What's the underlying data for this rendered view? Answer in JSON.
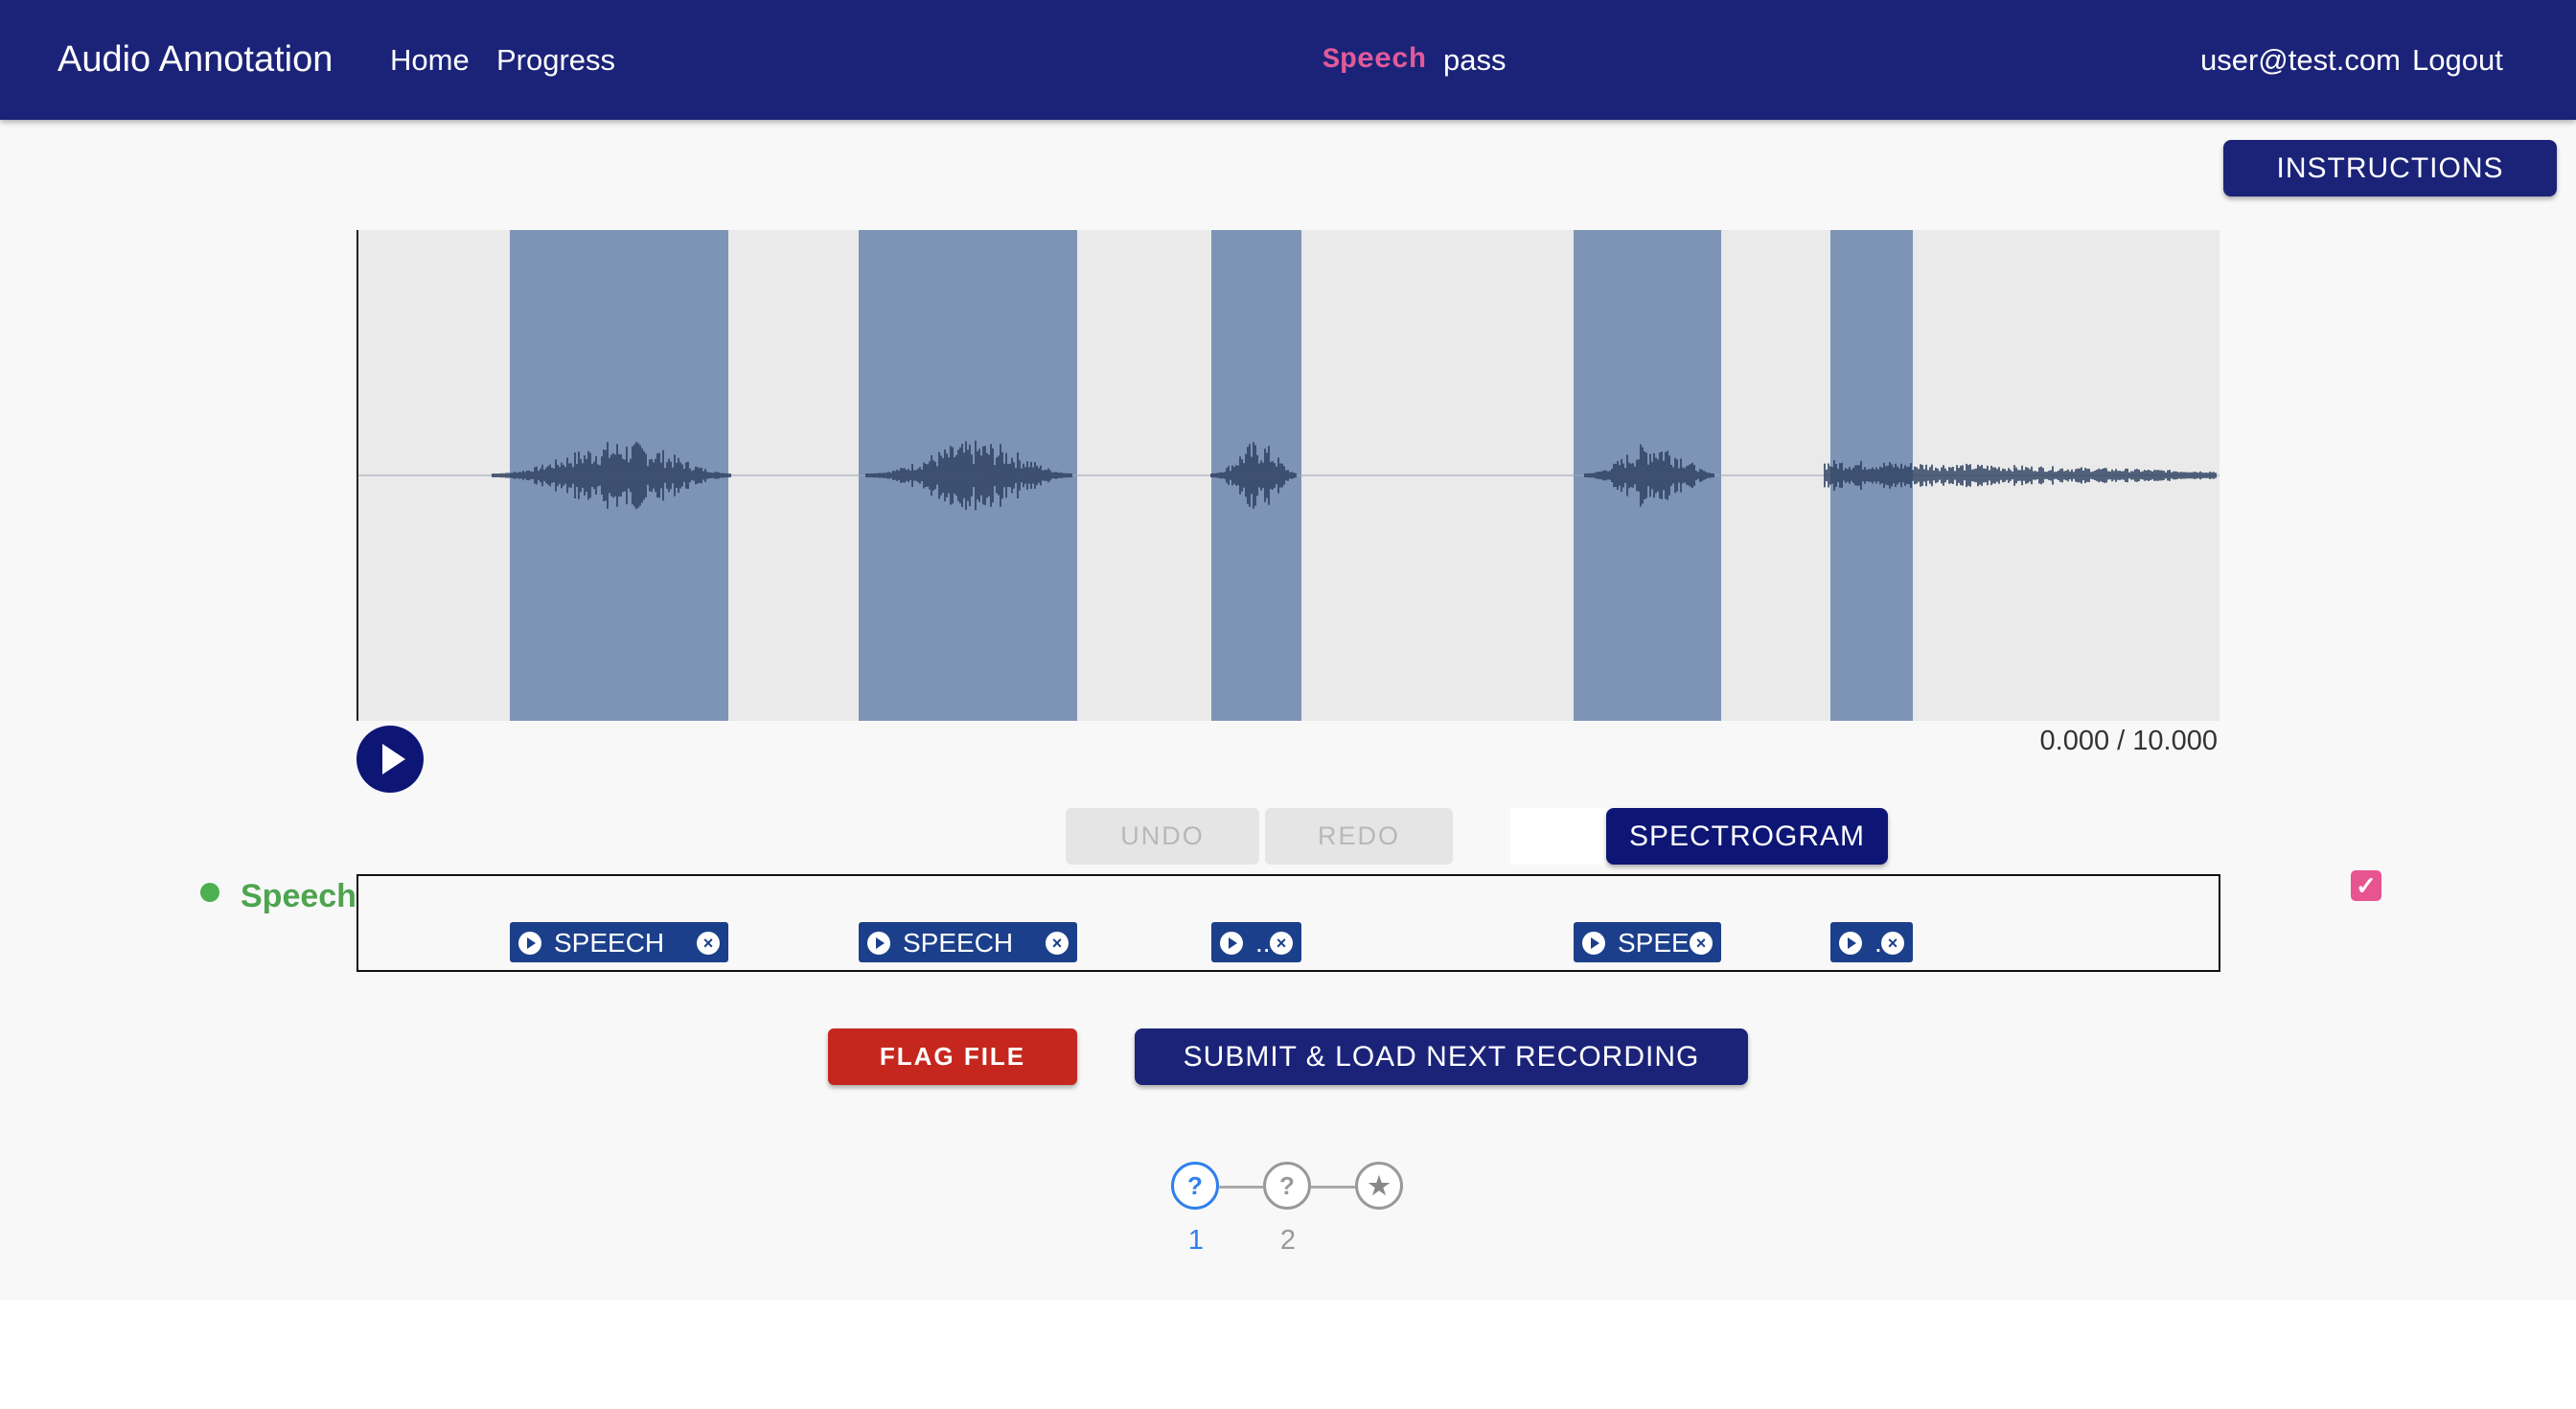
{
  "navbar": {
    "brand": "Audio Annotation",
    "links": [
      "Home",
      "Progress"
    ],
    "task_label": "Speech",
    "task_suffix": "pass",
    "user_email": "user@test.com",
    "logout": "Logout"
  },
  "instructions_label": "INSTRUCTIONS",
  "player": {
    "time": "0.000 / 10.000"
  },
  "toolbar": {
    "undo": "UNDO",
    "redo": "REDO",
    "spectrogram": "SPECTROGRAM"
  },
  "track": {
    "label": "Speech",
    "checked": true,
    "regions": [
      {
        "label": "SPEECH"
      },
      {
        "label": "SPEECH"
      },
      {
        "label": ".."
      },
      {
        "label": "SPEE"
      },
      {
        "label": "."
      }
    ]
  },
  "actions": {
    "flag": "FLAG FILE",
    "submit": "SUBMIT & LOAD NEXT RECORDING"
  },
  "stepper": {
    "steps": [
      {
        "icon": "?",
        "label": "1",
        "active": true
      },
      {
        "icon": "?",
        "label": "2",
        "active": false
      },
      {
        "icon": "★",
        "label": "",
        "active": false
      }
    ]
  },
  "colors": {
    "navbar": "#1b2379",
    "region": "#7d94b6",
    "flag": "#c5271f",
    "speech_label": "#4ea44f",
    "checkbox": "#e8548f",
    "step_active": "#2f80ed"
  },
  "icons": [
    "play-icon",
    "close-circle-icon",
    "check-icon",
    "star-icon"
  ]
}
